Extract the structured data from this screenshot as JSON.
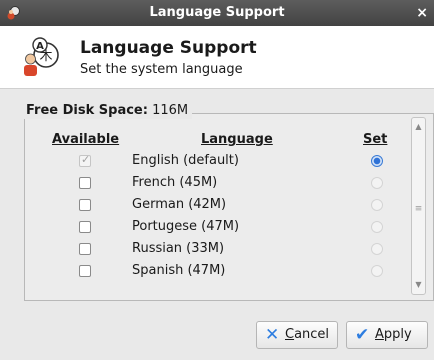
{
  "window": {
    "title": "Language Support",
    "close_glyph": "×"
  },
  "header": {
    "title": "Language Support",
    "subtitle": "Set the system language",
    "icon": "language-globe-icon"
  },
  "disk": {
    "label": "Free Disk Space:",
    "value": "116M"
  },
  "columns": {
    "available": "Available",
    "language": "Language",
    "set": "Set"
  },
  "languages": [
    {
      "label": "English (default)",
      "available": true,
      "available_disabled": true,
      "set": true
    },
    {
      "label": "French (45M)",
      "available": false,
      "set": false
    },
    {
      "label": "German (42M)",
      "available": false,
      "set": false
    },
    {
      "label": "Portugese (47M)",
      "available": false,
      "set": false
    },
    {
      "label": "Russian (33M)",
      "available": false,
      "set": false
    },
    {
      "label": "Spanish (47M)",
      "available": false,
      "set": false
    }
  ],
  "buttons": {
    "cancel": "Cancel",
    "apply": "Apply"
  },
  "colors": {
    "accent": "#2d7de0",
    "titlebar": "#4a4a4a"
  }
}
